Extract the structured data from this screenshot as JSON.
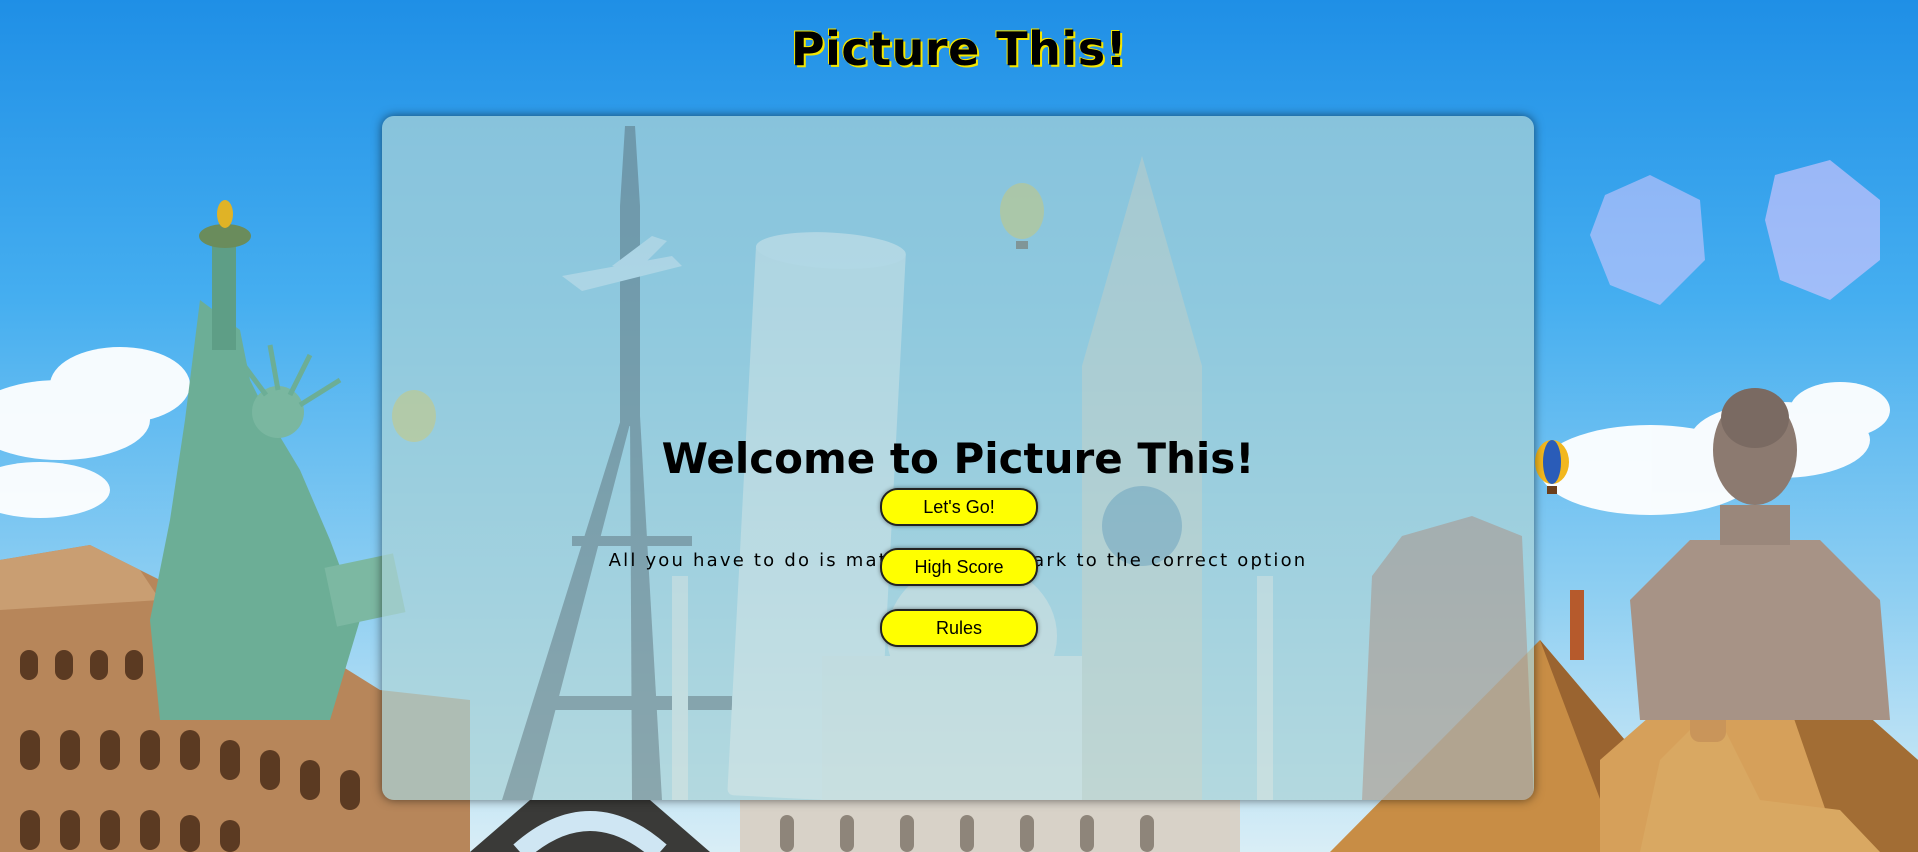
{
  "header": {
    "title": "Picture This!"
  },
  "main": {
    "welcome_heading": "Welcome to Picture This!",
    "tagline": "All you have to do is match the landmark to the correct option",
    "buttons": {
      "lets_go": "Let's Go!",
      "high_score": "High Score",
      "rules": "Rules"
    }
  },
  "colors": {
    "button_fill": "#ffff00",
    "title_glow": "#f4e600",
    "sky": "#45aef0"
  },
  "background": {
    "landmarks": [
      "statue-of-liberty",
      "colosseum",
      "eiffel-tower",
      "leaning-tower-of-pisa",
      "taj-mahal",
      "big-ben",
      "pyramids",
      "sphinx",
      "buddha-statue"
    ]
  }
}
